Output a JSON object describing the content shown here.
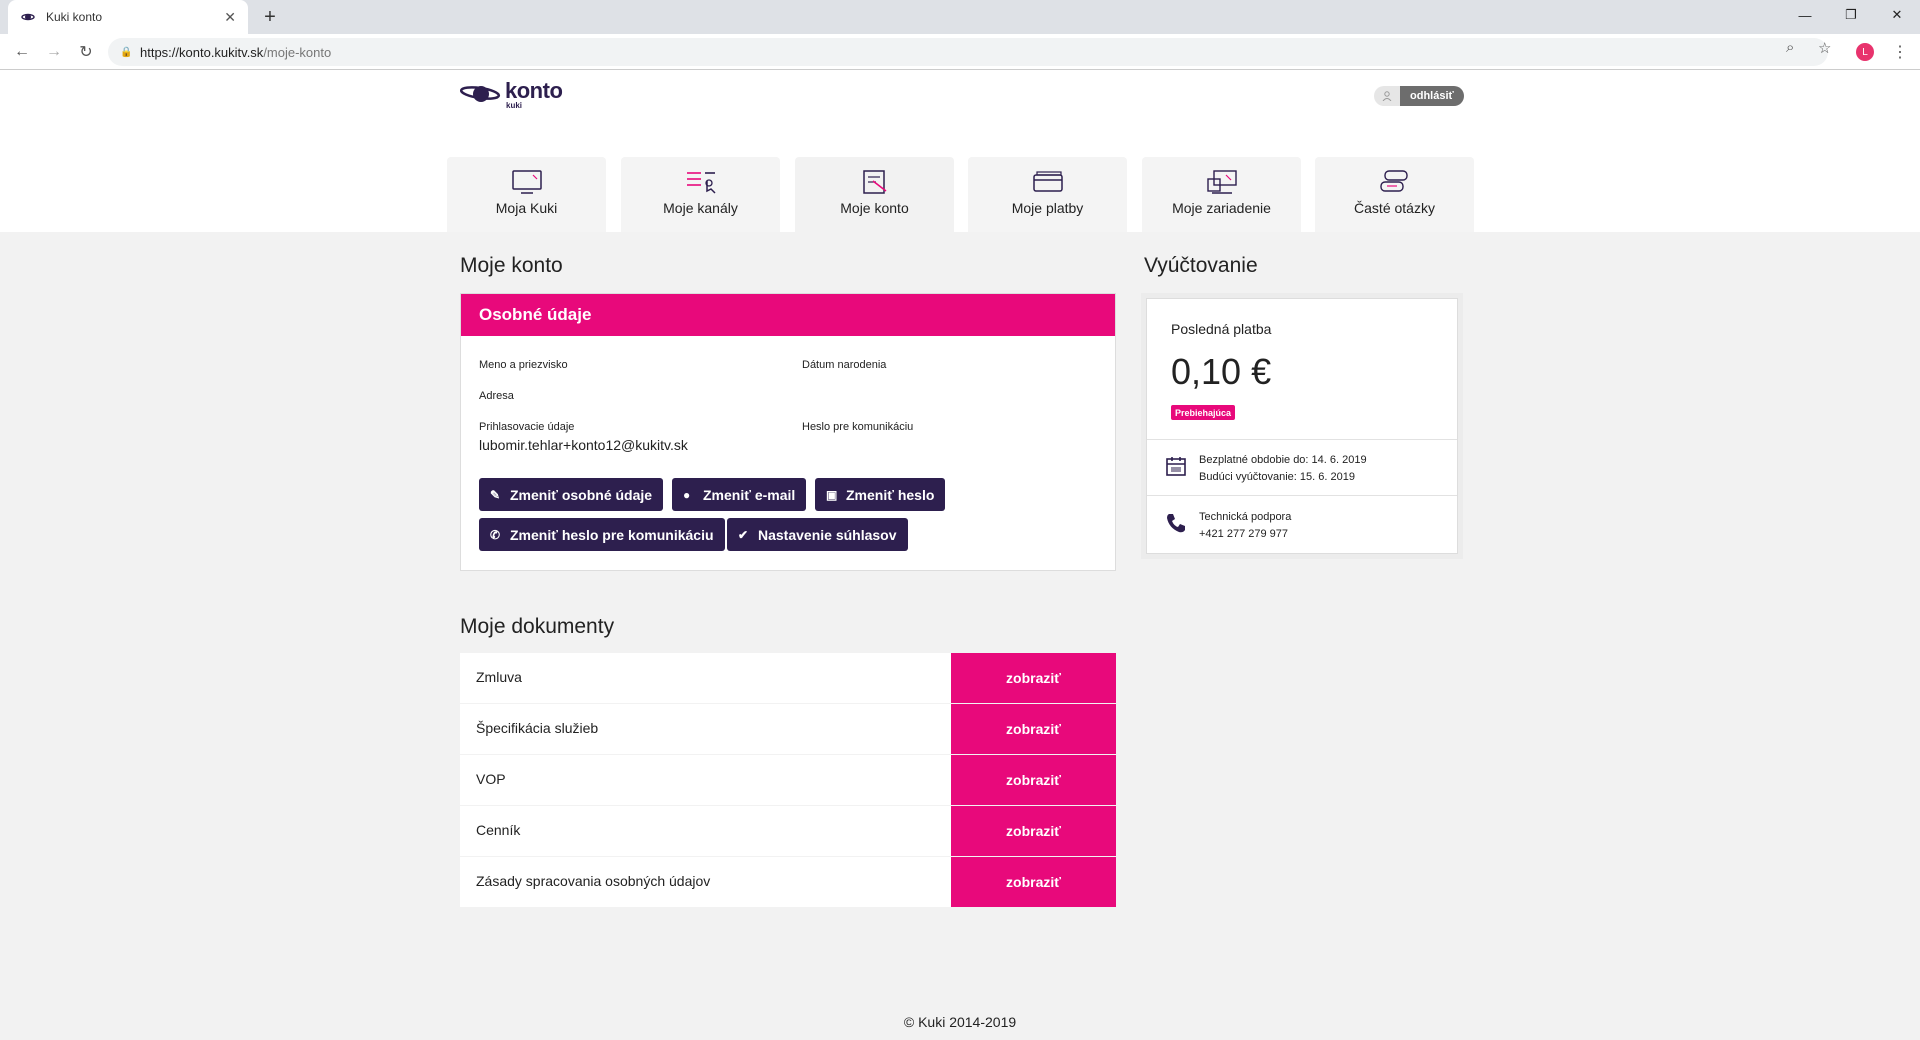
{
  "browser": {
    "tab_title": "Kuki konto",
    "url_host": "https://konto.kukitv.sk",
    "url_path": "/moje-konto",
    "profile_initial": "L"
  },
  "header": {
    "logo_word": "konto",
    "logo_sub": "kuki",
    "logout_label": "odhlásiť"
  },
  "nav": {
    "tabs": [
      {
        "label": "Moja Kuki",
        "icon": "tv-icon"
      },
      {
        "label": "Moje kanály",
        "icon": "channel-list-icon"
      },
      {
        "label": "Moje konto",
        "icon": "account-icon",
        "active": true
      },
      {
        "label": "Moje platby",
        "icon": "payments-icon"
      },
      {
        "label": "Moje zariadenie",
        "icon": "devices-icon"
      },
      {
        "label": "Časté otázky",
        "icon": "faq-icon"
      }
    ]
  },
  "account": {
    "section_title": "Moje konto",
    "card_title": "Osobné údaje",
    "name_label": "Meno a priezvisko",
    "birth_label": "Dátum narodenia",
    "address_label": "Adresa",
    "login_label": "Prihlasovacie údaje",
    "login_value": "lubomir.tehlar+konto12@kukitv.sk",
    "comm_pass_label": "Heslo pre komunikáciu",
    "buttons": {
      "change_personal": "Zmeniť osobné údaje",
      "change_email": "Zmeniť e-mail",
      "change_password": "Zmeniť heslo",
      "change_comm_password": "Zmeniť heslo pre komunikáciu",
      "consent_settings": "Nastavenie súhlasov"
    }
  },
  "billing": {
    "section_title": "Vyúčtovanie",
    "last_payment_label": "Posledná platba",
    "amount": "0,10 €",
    "status_badge": "Prebiehajúca",
    "free_period": "Bezplatné obdobie do: 14. 6. 2019",
    "next_billing": "Budúci vyúčtovanie: 15. 6. 2019",
    "support_label": "Technická podpora",
    "support_phone": "+421 277 279 977"
  },
  "documents": {
    "section_title": "Moje dokumenty",
    "button_label": "zobraziť",
    "items": [
      {
        "name": "Zmluva"
      },
      {
        "name": "Špecifikácia služieb"
      },
      {
        "name": "VOP"
      },
      {
        "name": "Cenník"
      },
      {
        "name": "Zásady spracovania osobných údajov"
      }
    ]
  },
  "footer": {
    "copyright": "© Kuki 2014-2019"
  },
  "colors": {
    "brand_pink": "#e8097b",
    "brand_purple": "#2d1f4e"
  }
}
